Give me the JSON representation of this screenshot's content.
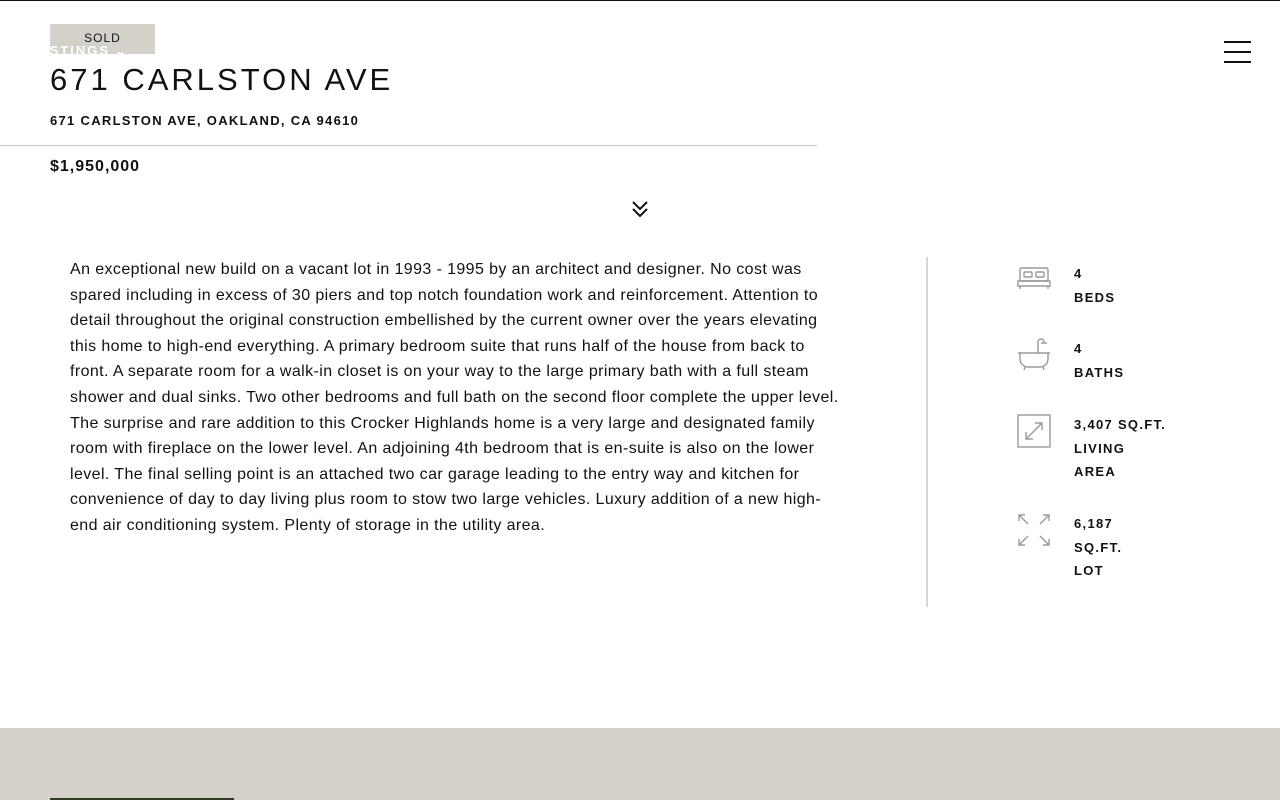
{
  "header": {
    "status_badge": "SOLD",
    "nav_link": "ISTINGS",
    "nav_chevron": "⌄",
    "menu_icon": "hamburger-menu-icon"
  },
  "listing": {
    "title": "671 CARLSTON AVE",
    "address": "671 CARLSTON AVE, OAKLAND, CA 94610",
    "price": "$1,950,000",
    "description": "An exceptional new build on a vacant lot in 1993 - 1995 by an architect and designer. No cost was spared including in excess of 30 piers and top notch foundation work and reinforcement. Attention to detail throughout the original construction embellished by the current owner over the years elevating this home to high-end everything. A primary bedroom suite that runs half of the house from back to front. A separate room for a walk-in closet is on your way to the large primary bath with a full steam shower and dual sinks. Two other bedrooms and full bath on the second floor complete the upper level. The surprise and rare addition to this Crocker Highlands home is a very large and designated family room with fireplace on the lower level. An adjoining 4th bedroom that is en-suite is also on the lower level. The final selling point is an attached two car garage leading to the entry way and kitchen for convenience of day to day living plus room to stow two large vehicles. Luxury addition of a new high-end air conditioning system. Plenty of storage in the utility area."
  },
  "stats": {
    "beds": {
      "value": "4",
      "label": "BEDS",
      "icon": "bed-icon"
    },
    "baths": {
      "value": "4",
      "label": "BATHS",
      "icon": "bathtub-icon"
    },
    "living": {
      "value": "3,407 SQ.FT.",
      "label_line1": "LIVING",
      "label_line2": "AREA",
      "icon": "expand-square-icon"
    },
    "lot": {
      "value": "6,187",
      "label_line1": "SQ.FT.",
      "label_line2": "LOT",
      "icon": "expand-arrows-icon"
    }
  },
  "colors": {
    "badge_bg": "#d4d1cb",
    "footer_bg": "#d4d1cb",
    "text": "#111111",
    "icon_stroke": "#9a9a9a"
  }
}
